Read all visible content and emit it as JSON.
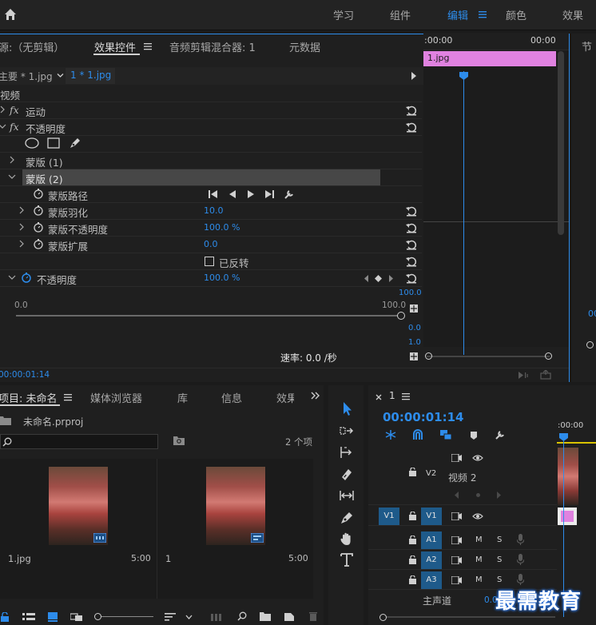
{
  "top_bar": {
    "workspaces": [
      "学习",
      "组件",
      "编辑",
      "颜色",
      "效果"
    ],
    "active": "编辑"
  },
  "effect_controls": {
    "tabs": {
      "source": "源:（无剪辑）",
      "effect_controls": "效果控件",
      "audio_mixer": "音频剪辑混合器: 1",
      "metadata": "元数据",
      "right_partial": "节"
    },
    "master_clip": "主要 * 1.jpg",
    "sequence_clip": "1 * 1.jpg",
    "video_header": "视频",
    "timecode_start": ":00:00",
    "timecode_end": "00:00",
    "timeline_clip": "1.jpg",
    "effects": {
      "motion": "运动",
      "opacity": "不透明度",
      "fx": "fx"
    },
    "masks": {
      "mask1": "蒙版 (1)",
      "mask2": "蒙版 (2)",
      "mask_path": "蒙版路径",
      "feather": "蒙版羽化",
      "feather_value": "10.0",
      "mask_opacity": "蒙版不透明度",
      "mask_opacity_value": "100.0 %",
      "expansion": "蒙版扩展",
      "expansion_value": "0.0",
      "inverted": "已反转"
    },
    "opacity_prop": "不透明度",
    "opacity_value": "100.0 %",
    "slider_min": "0.0",
    "slider_max": "100.0",
    "graph_top": "100.0",
    "graph_bottom": "0.0",
    "velocity_top": "1.0",
    "velocity_label": "速率: 0.0 /秒",
    "current_time": "00:00:01:14",
    "right_value": "00"
  },
  "project": {
    "tabs": [
      "项目: 未命名",
      "媒体浏览器",
      "库",
      "信息",
      "效果"
    ],
    "file_name": "未命名.prproj",
    "item_count": "2 个项",
    "items": [
      {
        "name": "1.jpg",
        "duration": "5:00"
      },
      {
        "name": "1",
        "duration": "5:00"
      }
    ]
  },
  "sequence": {
    "name": "1",
    "timecode": "00:00:01:14",
    "ruler_label": ":00:00",
    "tracks": {
      "v2": "V2",
      "v2_name": "视频 2",
      "v1": "V1",
      "a1": "A1",
      "a2": "A2",
      "a3": "A3",
      "master": "主声道",
      "master_value": "0.0",
      "m": "M",
      "s": "S"
    }
  },
  "watermark": "最需教育",
  "colors": {
    "accent": "#2d8ceb",
    "clip_pink": "#e082e0",
    "target_blue": "#1e5a8a"
  }
}
